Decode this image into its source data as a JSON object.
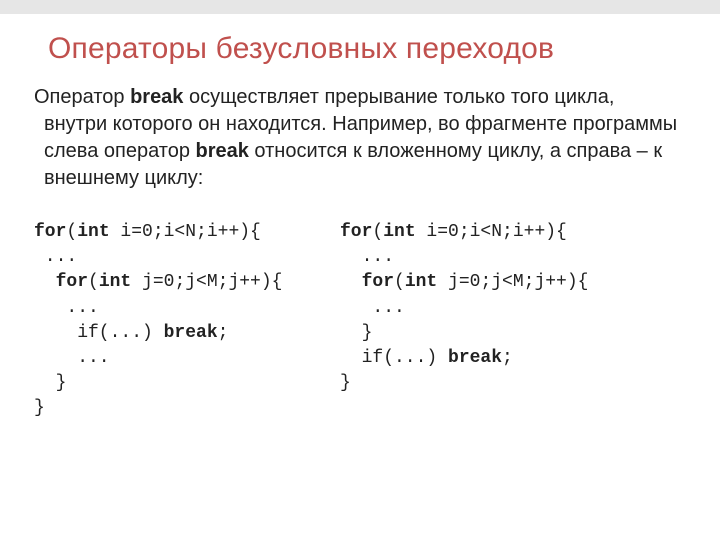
{
  "title": "Операторы безусловных переходов",
  "paragraph": {
    "pre1": "Оператор ",
    "b1": "break",
    "mid": "  осуществляет   прерывание   только того   цикла,    внутри    которого   он     находится. Например,   во    фрагменте    программы    слева оператор ",
    "b2": "break",
    "post": "   относится к вложенному циклу, а справа – к внешнему циклу:"
  },
  "code_left": {
    "l1a": "for",
    "l1b": "(",
    "l1c": "int",
    "l1d": " i=0;i<N;i++){",
    "l2": " ...",
    "l3a": "  ",
    "l3b": "for",
    "l3c": "(",
    "l3d": "int",
    "l3e": " j=0;j<M;j++){",
    "l4": "   ...",
    "l5a": "    if(...) ",
    "l5b": "break",
    "l5c": ";",
    "l6": "    ...",
    "l7": "  }",
    "l8": "}"
  },
  "code_right": {
    "l1a": "for",
    "l1b": "(",
    "l1c": "int",
    "l1d": " i=0;i<N;i++){",
    "l2": "  ...",
    "l3a": "  ",
    "l3b": "for",
    "l3c": "(",
    "l3d": "int",
    "l3e": " j=0;j<M;j++){",
    "l4": "   ...",
    "l5": "  }",
    "l6a": "  if(...) ",
    "l6b": "break",
    "l6c": ";",
    "l7": "}"
  }
}
